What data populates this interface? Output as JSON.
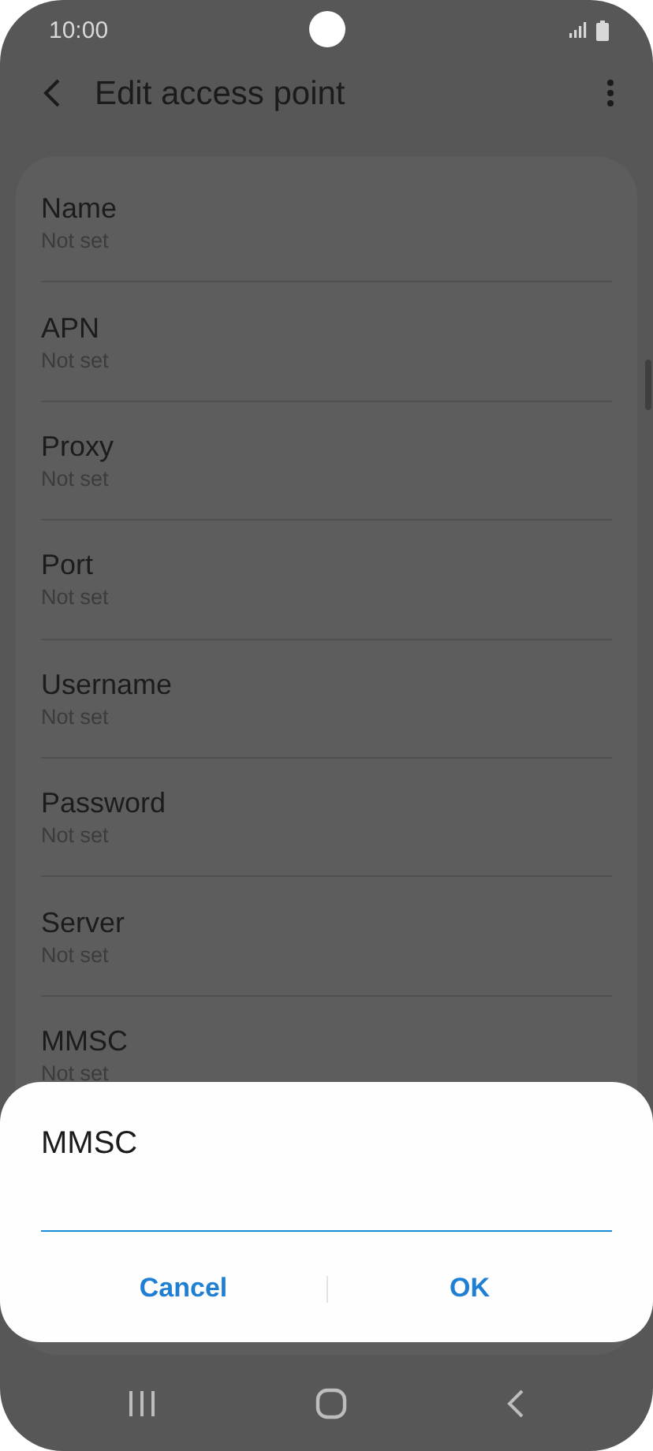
{
  "status_bar": {
    "time": "10:00"
  },
  "app_bar": {
    "title": "Edit access point"
  },
  "fields": [
    {
      "label": "Name",
      "value": "Not set"
    },
    {
      "label": "APN",
      "value": "Not set"
    },
    {
      "label": "Proxy",
      "value": "Not set"
    },
    {
      "label": "Port",
      "value": "Not set"
    },
    {
      "label": "Username",
      "value": "Not set"
    },
    {
      "label": "Password",
      "value": "Not set"
    },
    {
      "label": "Server",
      "value": "Not set"
    },
    {
      "label": "MMSC",
      "value": "Not set"
    }
  ],
  "dialog": {
    "title": "MMSC",
    "buttons": [
      "Cancel",
      "OK"
    ]
  }
}
